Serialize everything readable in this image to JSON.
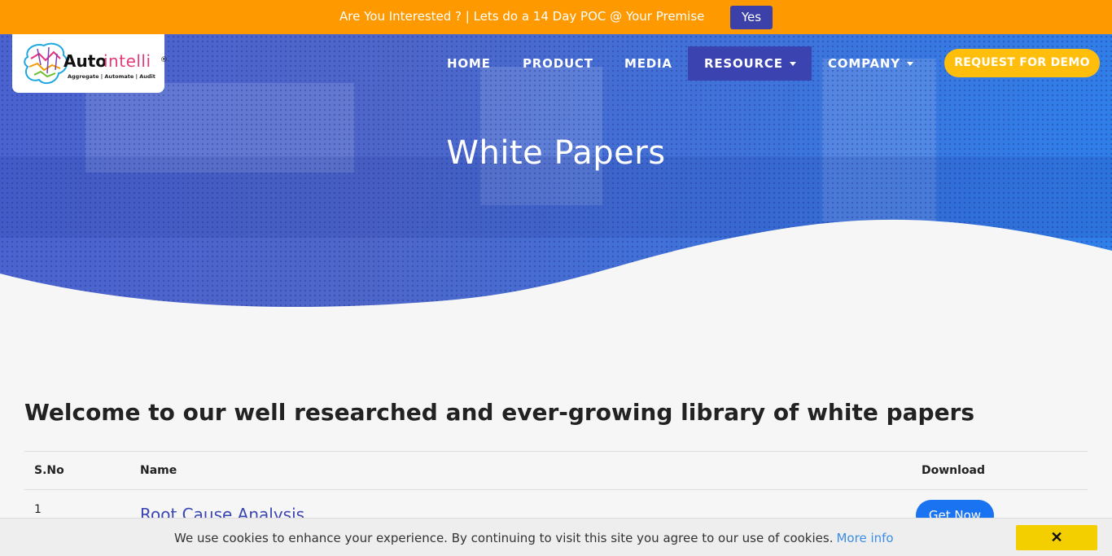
{
  "promo": {
    "text": "Are You Interested ? | Lets do a 14 Day POC @ Your Premise",
    "button": "Yes"
  },
  "logo": {
    "name_part1": "Auto",
    "name_part2": "intelli",
    "registered": "®",
    "tagline": "Aggregate | Automate | Audit"
  },
  "nav": {
    "items": [
      {
        "label": "HOME"
      },
      {
        "label": "PRODUCT"
      },
      {
        "label": "MEDIA"
      },
      {
        "label": "RESOURCE"
      },
      {
        "label": "COMPANY"
      }
    ],
    "active": "RESOURCE",
    "cta": "REQUEST FOR DEMO"
  },
  "hero": {
    "title": "White Papers"
  },
  "main": {
    "intro": "Welcome to our well researched and ever-growing library of white papers",
    "table": {
      "headers": [
        "S.No",
        "Name",
        "Download"
      ],
      "rows": [
        {
          "sno": "1",
          "name": "Root Cause Analysis",
          "action": "Get Now"
        }
      ]
    }
  },
  "cookie": {
    "text": "We use cookies to enhance your experience. By continuing to visit this site you agree to our use of cookies.",
    "link": "More info",
    "close": "✕"
  },
  "colors": {
    "promo_bg": "#ff9900",
    "accent_blue": "#3b43b0",
    "cta_yellow": "#ffbe0b",
    "button_blue": "#1a73f0",
    "cookie_close": "#f4cf00"
  }
}
